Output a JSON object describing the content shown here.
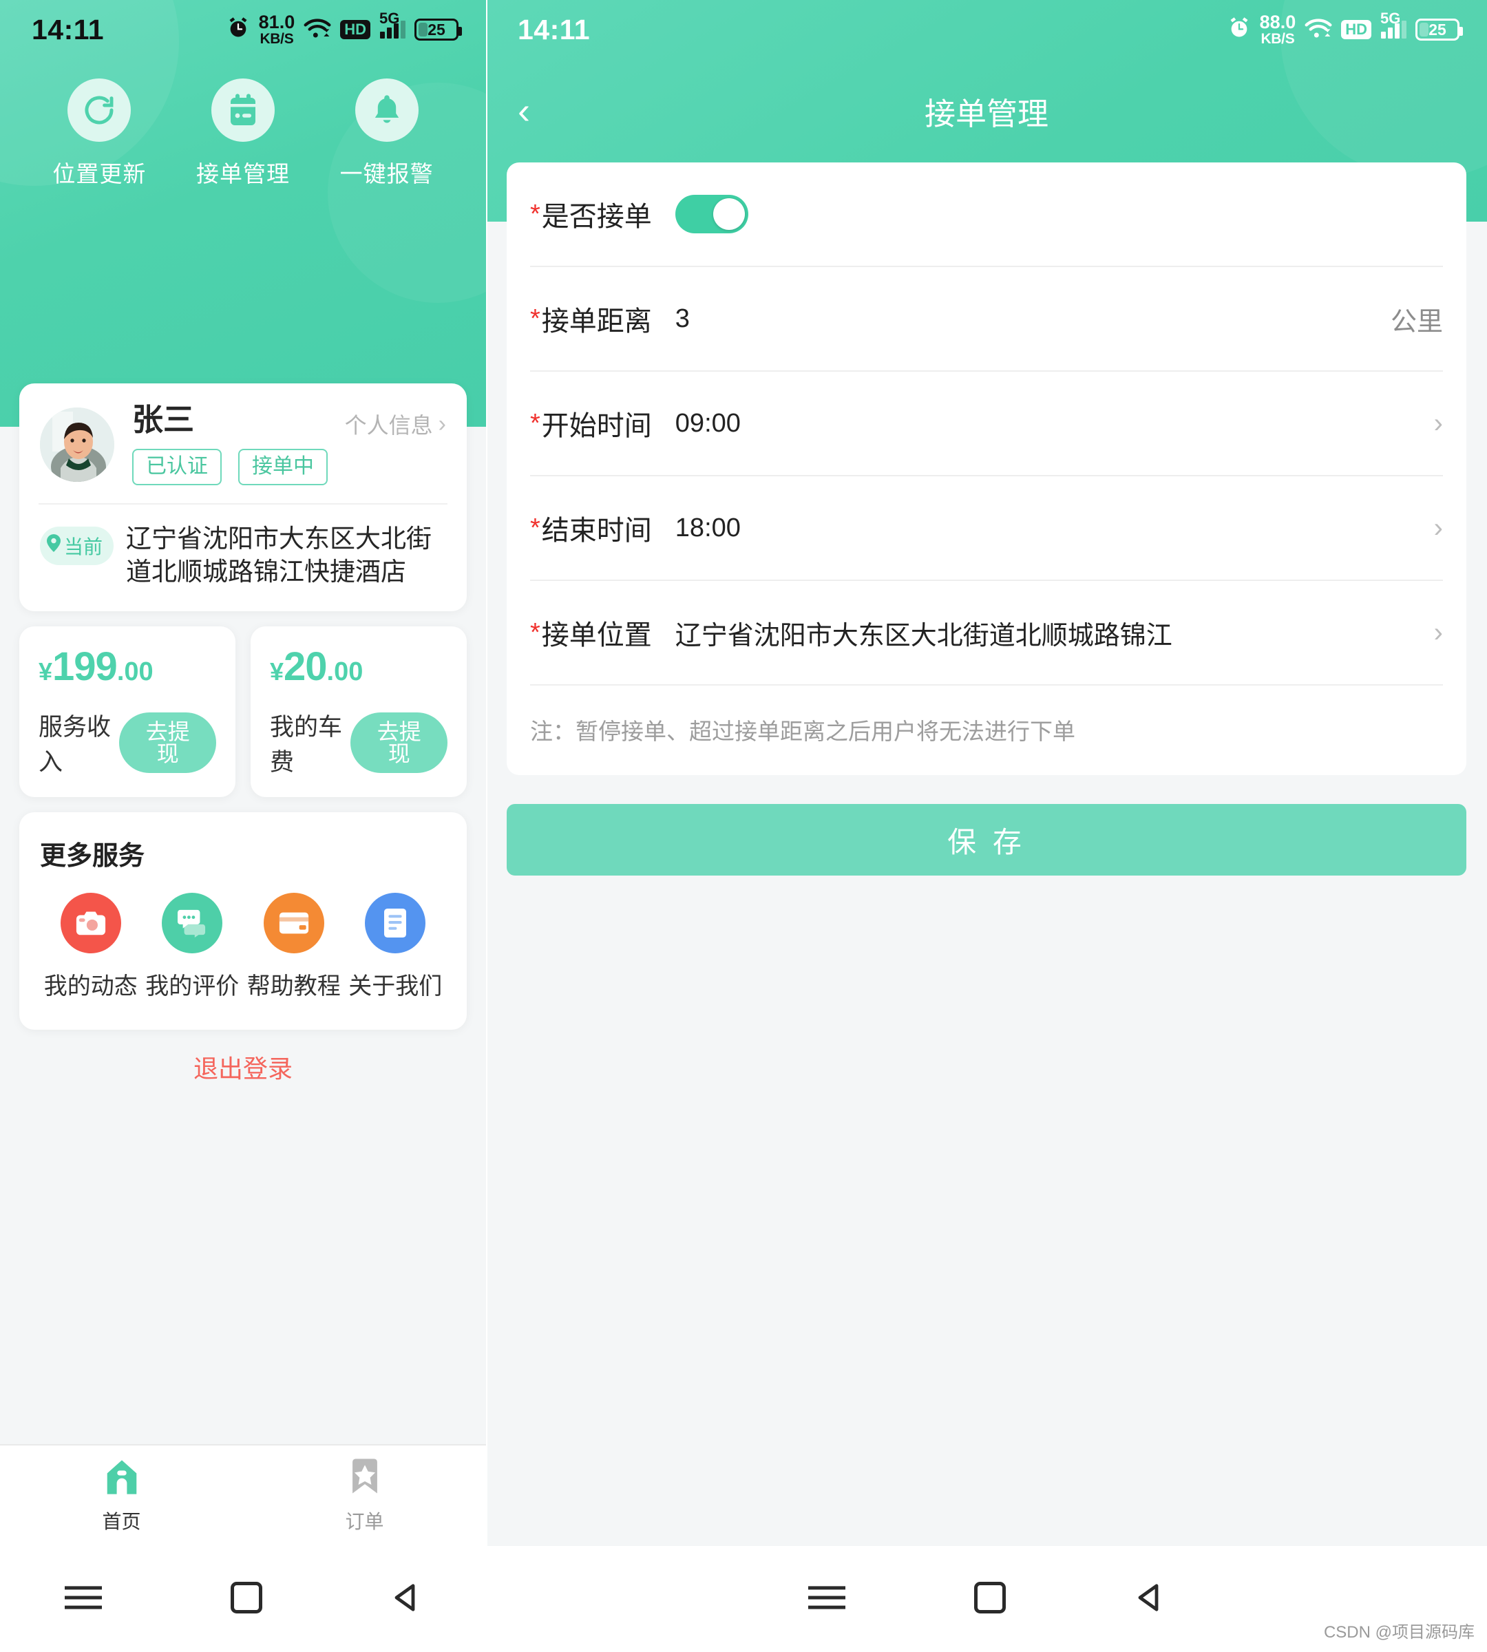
{
  "left_screen": {
    "status_bar": {
      "time": "14:11",
      "net_speed_value": "81.0",
      "net_speed_unit": "KB/S",
      "hd_label": "HD",
      "network_label": "5G",
      "battery_level": "25",
      "icons": [
        "alarm-icon",
        "wifi-icon",
        "hd-icon",
        "signal-icon",
        "battery-icon"
      ]
    },
    "quick_actions": [
      {
        "label": "位置更新",
        "icon": "refresh-icon"
      },
      {
        "label": "接单管理",
        "icon": "calendar-icon"
      },
      {
        "label": "一键报警",
        "icon": "bell-icon"
      }
    ],
    "profile": {
      "name": "张三",
      "tags": [
        "已认证",
        "接单中"
      ],
      "personal_info_link": "个人信息",
      "location_chip": "当前",
      "location_text": "辽宁省沈阳市大东区大北街道北顺城路锦江快捷酒店"
    },
    "money_cards": [
      {
        "yen": "¥",
        "integer": "199",
        "decimal": ".00",
        "label": "服务收入",
        "button": "去提现"
      },
      {
        "yen": "¥",
        "integer": "20",
        "decimal": ".00",
        "label": "我的车费",
        "button": "去提现"
      }
    ],
    "services": {
      "title": "更多服务",
      "items": [
        {
          "label": "我的动态",
          "icon": "camera-icon",
          "color": "#f4554a"
        },
        {
          "label": "我的评价",
          "icon": "chat-icon",
          "color": "#4ecfa8"
        },
        {
          "label": "帮助教程",
          "icon": "wallet-icon",
          "color": "#f48a34"
        },
        {
          "label": "关于我们",
          "icon": "document-icon",
          "color": "#5494f0"
        }
      ]
    },
    "logout_label": "退出登录",
    "bottom_nav": [
      {
        "label": "首页",
        "icon": "home-icon",
        "active": true
      },
      {
        "label": "订单",
        "icon": "bookmark-star-icon",
        "active": false
      }
    ]
  },
  "right_screen": {
    "status_bar": {
      "time": "14:11",
      "net_speed_value": "88.0",
      "net_speed_unit": "KB/S",
      "hd_label": "HD",
      "network_label": "5G",
      "battery_level": "25"
    },
    "header": {
      "title": "接单管理",
      "back_icon": "chevron-left-icon"
    },
    "form": {
      "rows": [
        {
          "label": "是否接单",
          "required": true,
          "type": "toggle",
          "value": "on"
        },
        {
          "label": "接单距离",
          "required": true,
          "type": "input",
          "value": "3",
          "unit": "公里"
        },
        {
          "label": "开始时间",
          "required": true,
          "type": "picker",
          "value": "09:00"
        },
        {
          "label": "结束时间",
          "required": true,
          "type": "picker",
          "value": "18:00"
        },
        {
          "label": "接单位置",
          "required": true,
          "type": "picker",
          "value": "辽宁省沈阳市大东区大北街道北顺城路锦江"
        }
      ],
      "note": "注：暂停接单、超过接单距离之后用户将无法进行下单"
    },
    "save_button": "保 存"
  },
  "watermark": "CSDN @项目源码库",
  "colors": {
    "brand_green": "#4ed2ac",
    "light_green": "#ddf7ef",
    "required_red": "#f0312d",
    "logout_red": "#f4655c"
  }
}
